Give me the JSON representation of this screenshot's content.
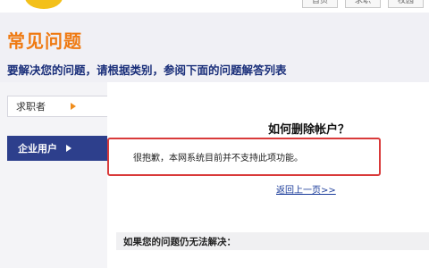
{
  "header": {
    "nav": [
      "首页",
      "求职",
      "校园"
    ],
    "title": "常见问题",
    "subtitle": "要解决您的问题，请根据类别，参阅下面的问题解答列表"
  },
  "sidebar": {
    "items": [
      {
        "label": "求职者",
        "active": false
      },
      {
        "label": "企业用户",
        "active": true
      }
    ]
  },
  "main": {
    "question": "如何删除帐户？",
    "answer": "很抱歉，本网系统目前并不支持此项功能。",
    "back_link": "返回上一页>>",
    "help_heading": "如果您的问题仍无法解决："
  },
  "colors": {
    "title_orange": "#ef7a12",
    "subtitle_navy": "#1a2f7a",
    "active_tab": "#2d3f8c",
    "highlight_border": "#d93a3a"
  }
}
